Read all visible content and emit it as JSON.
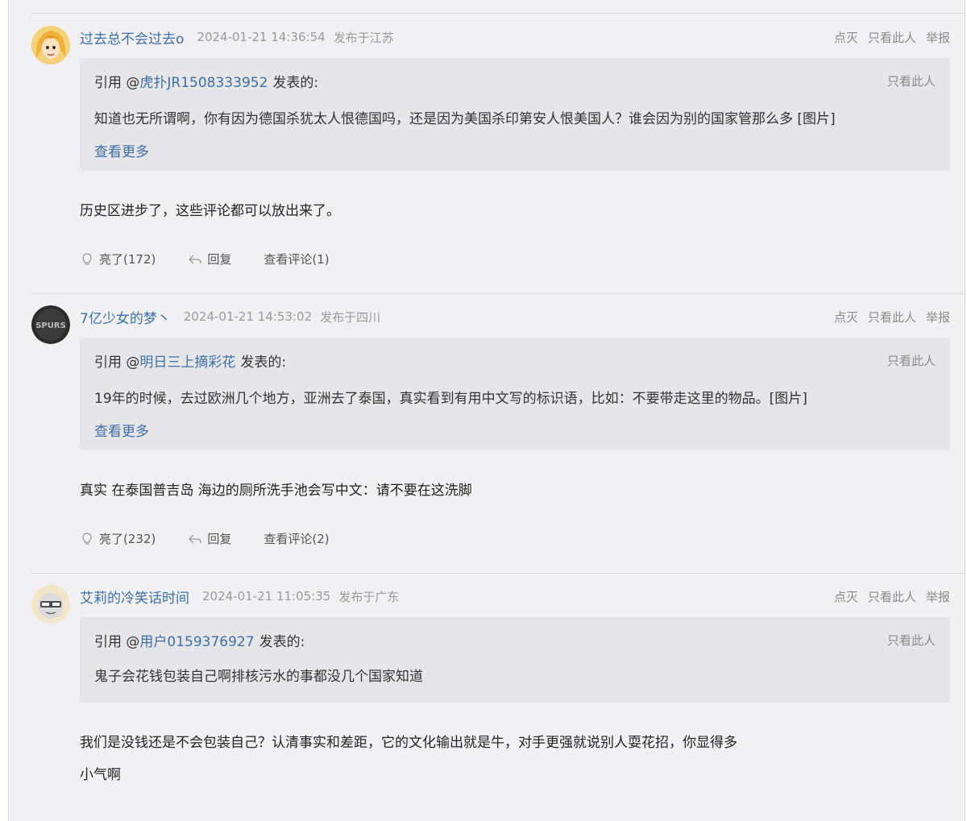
{
  "posts": [
    {
      "username": "过去总不会过去o",
      "timestamp": "2024-01-21 14:36:54",
      "location": "发布于江苏",
      "actions": {
        "dim": "点灭",
        "only_this": "只看此人",
        "report": "举报"
      },
      "quote": {
        "prefix": "引用 @",
        "user": "虎扑JR1508333952",
        "suffix": "发表的:",
        "only_this": "只看此人",
        "text": "知道也无所谓啊，你有因为德国杀犹太人恨德国吗，还是因为美国杀印第安人恨美国人？谁会因为别的国家管那么多 [图片]",
        "see_more": "查看更多"
      },
      "body": "历史区进步了，这些评论都可以放出来了。",
      "footer": {
        "light": "亮了(172)",
        "reply": "回复",
        "comments": "查看评论(1)"
      }
    },
    {
      "username": "7亿少女的梦丶",
      "timestamp": "2024-01-21 14:53:02",
      "location": "发布于四川",
      "actions": {
        "dim": "点灭",
        "only_this": "只看此人",
        "report": "举报"
      },
      "quote": {
        "prefix": "引用 @",
        "user": "明日三上摘彩花",
        "suffix": "发表的:",
        "only_this": "只看此人",
        "text": "19年的时候，去过欧洲几个地方，亚洲去了泰国，真实看到有用中文写的标识语，比如：不要带走这里的物品。[图片]",
        "see_more": "查看更多"
      },
      "body": "真实 在泰国普吉岛 海边的厕所洗手池会写中文：请不要在这洗脚",
      "footer": {
        "light": "亮了(232)",
        "reply": "回复",
        "comments": "查看评论(2)"
      }
    },
    {
      "username": "艾莉的冷笑话时间",
      "timestamp": "2024-01-21 11:05:35",
      "location": "发布于广东",
      "actions": {
        "dim": "点灭",
        "only_this": "只看此人",
        "report": "举报"
      },
      "quote": {
        "prefix": "引用 @",
        "user": "用户0159376927",
        "suffix": "发表的:",
        "only_this": "只看此人",
        "text": "鬼子会花钱包装自己啊排核污水的事都没几个国家知道"
      },
      "body_line1": "我们是没钱还是不会包装自己？认清事实和差距，它的文化输出就是牛，对手更强就说别人耍花招，你显得多",
      "body_line2": "小气啊"
    }
  ],
  "colors": {
    "link": "#3d6fa8",
    "background": "#f1f1f3",
    "quote_bg": "#e6e6e8",
    "muted": "#9a9a9a"
  }
}
